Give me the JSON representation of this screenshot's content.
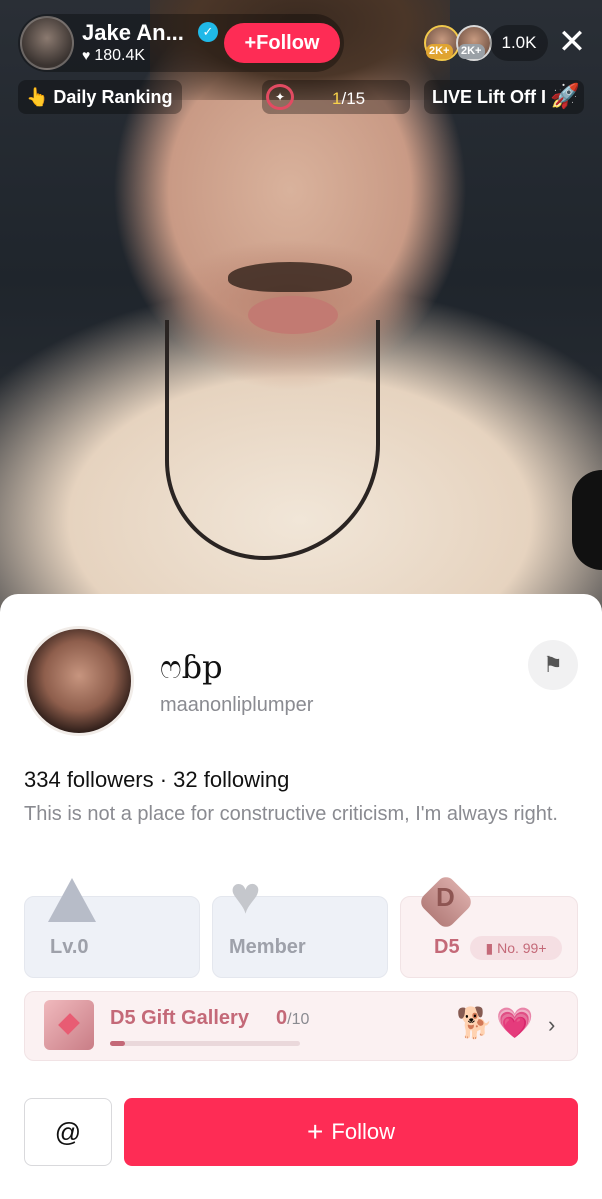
{
  "host": {
    "name": "Jake An...",
    "likes": "180.4K",
    "follow_label": "Follow",
    "viewer_badge_1": "2K+",
    "viewer_badge_2": "2K+",
    "viewer_count": "1.0K"
  },
  "ranking": {
    "label": "Daily Ranking"
  },
  "goal": {
    "current": "1",
    "total": "/15"
  },
  "liftoff": {
    "label": "LIVE Lift Off I"
  },
  "profile": {
    "display_name": "ෆɓp",
    "username": "maanonliplumper",
    "followers_line": "334 followers · 32 following",
    "bio": "This is not a place for constructive criticism, I'm always right."
  },
  "stats": {
    "level_label": "Lv.0",
    "member_label": "Member",
    "d5_label": "D5",
    "d5_letter": "D",
    "rank_badge": "No. 99+"
  },
  "gallery": {
    "title": "D5 Gift Gallery",
    "count": "0",
    "total": "/10",
    "progress": 0.08
  },
  "actions": {
    "mention_label": "@",
    "follow_label": "Follow"
  },
  "icons": {
    "verified": "verified-check-icon",
    "close": "close-icon",
    "report": "flag-icon",
    "chevron": "chevron-right-icon"
  },
  "colors": {
    "accent": "#fe2c55",
    "d5_accent": "#c46978",
    "verified": "#20b9e8"
  }
}
